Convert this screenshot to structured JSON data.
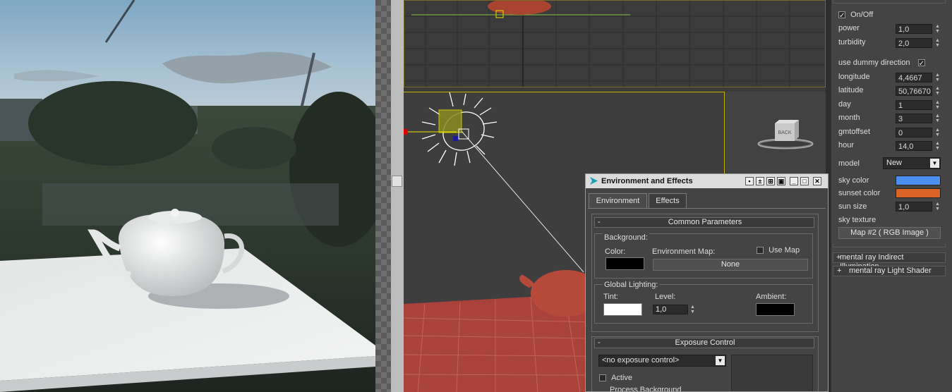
{
  "colors": {
    "sky_color": "#4d8ff0",
    "sunset_color": "#d96425",
    "teapot": "#b64a3a",
    "ground_grid": "#a8423a",
    "viewport_border": "#c8b400"
  },
  "sun_panel": {
    "onoff_label": "On/Off",
    "onoff_checked": true,
    "power_label": "power",
    "power_value": "1,0",
    "turbidity_label": "turbidity",
    "turbidity_value": "2,0",
    "dummy_label": "use dummy direction",
    "dummy_checked": true,
    "longitude_label": "longitude",
    "longitude_value": "4,4667",
    "latitude_label": "latitude",
    "latitude_value": "50,76670",
    "day_label": "day",
    "day_value": "1",
    "month_label": "month",
    "month_value": "3",
    "gmtoffset_label": "gmtoffset",
    "gmtoffset_value": "0",
    "hour_label": "hour",
    "hour_value": "14,0",
    "model_label": "model",
    "model_value": "New",
    "sky_color_label": "sky color",
    "sunset_color_label": "sunset color",
    "sun_size_label": "sun size",
    "sun_size_value": "1,0",
    "sky_texture_label": "sky texture",
    "sky_texture_button": "Map #2  ( RGB Image )"
  },
  "rollouts": {
    "indirect": "mental ray Indirect Illumination",
    "indirect_sign": "+",
    "light_shader": "mental ray Light Shader",
    "light_shader_sign": "+"
  },
  "viewcube_label": "BACK",
  "dialog": {
    "title": "Environment and Effects",
    "tabs": [
      "Environment",
      "Effects"
    ],
    "common_params": "Common Parameters",
    "common_sign": "-",
    "background_label": "Background:",
    "color_label": "Color:",
    "env_map_label": "Environment Map:",
    "use_map_label": "Use Map",
    "env_map_button": "None",
    "global_lighting_label": "Global Lighting:",
    "tint_label": "Tint:",
    "level_label": "Level:",
    "level_value": "1,0",
    "ambient_label": "Ambient:",
    "exposure_title": "Exposure Control",
    "exposure_sign": "-",
    "exposure_select": "<no exposure control>",
    "active_label": "Active",
    "process_bg_label": "Process Background"
  }
}
